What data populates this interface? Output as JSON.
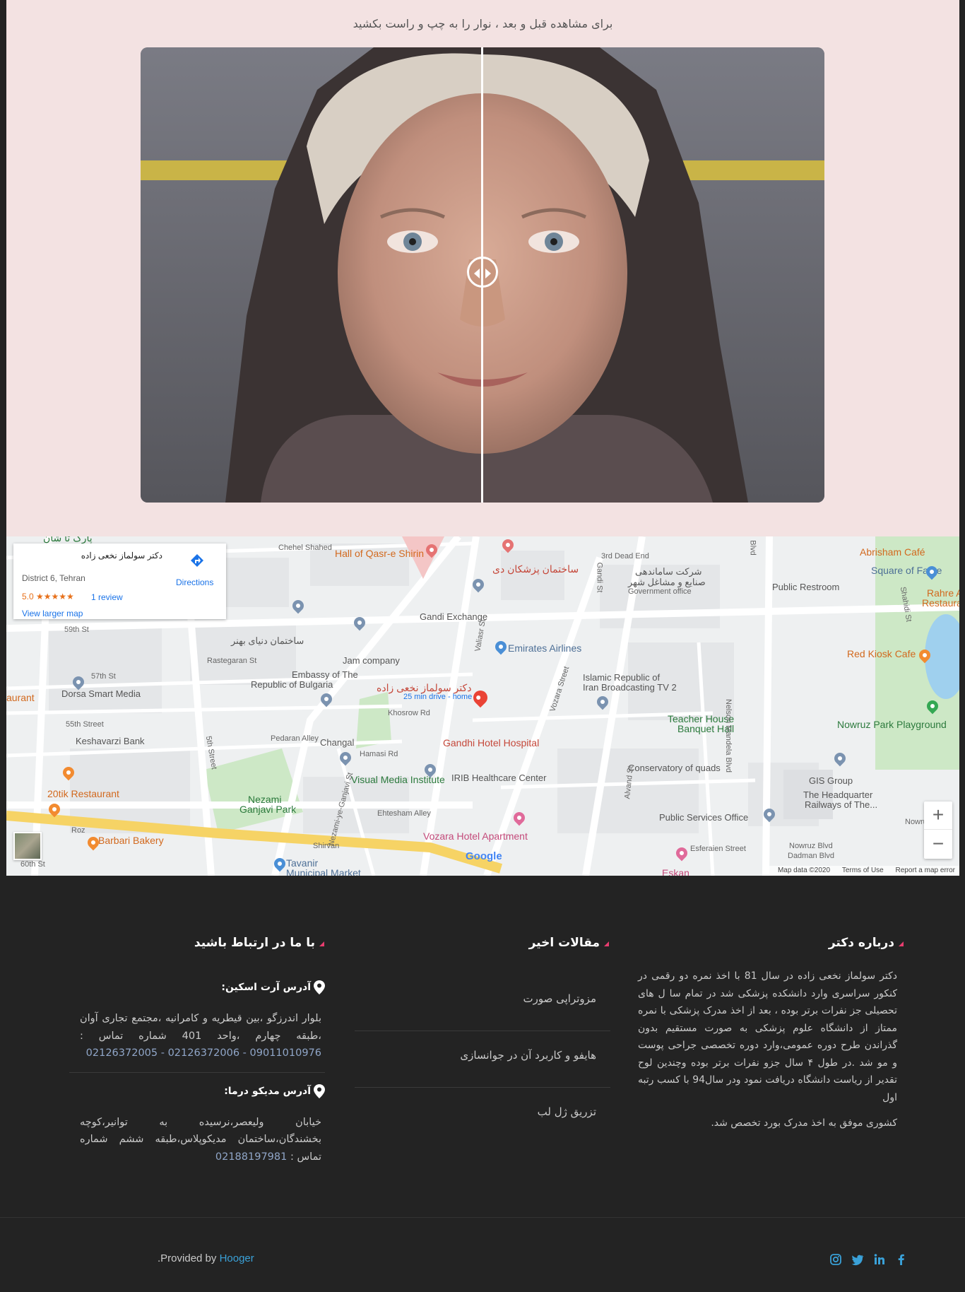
{
  "before_after": {
    "hint": "برای مشاهده قبل و بعد ، نوار را به چپ و راست بکشید"
  },
  "map": {
    "card": {
      "place_name": "دکتر سولماز نخعی زاده",
      "area": "District 6, Tehran",
      "rating": "5.0 ★★★★★",
      "reviews": "1 review",
      "larger_map": "View larger map",
      "directions": "Directions"
    },
    "labels": {
      "park_top": "پارک تا شان",
      "chehel_shahed": "Chehel Shahed",
      "hall_qasr": "Hall of Qasr-e Shirin",
      "medical_building": "ساختمان پزشکان دی",
      "third_dead_end": "3rd Dead End",
      "gandi_st": "Gandi St",
      "blvd": "Blvd",
      "gov_org": "شرکت ساماندهی",
      "gov_org2": "صنایع و مشاغل شهر",
      "gov_office": "Government office",
      "public_restroom": "Public Restroom",
      "abrisham_cafe": "Abrisham Café",
      "square_of_fame": "Square of Fame",
      "rahre_restaurant": "Rahre Abi Ca",
      "restaurant2": "Restaura",
      "gandi_exchange": "Gandi Exchange",
      "st59": "59th St",
      "building_dubai": "ساختمان دنیای بهنر",
      "rastegaran": "Rastegaran St",
      "jam_company": "Jam company",
      "emirates": "Emirates Airlines",
      "st57": "57th St",
      "embassy1": "Embassy of The",
      "embassy2": "Republic of Bulgaria",
      "dorsa": "Dorsa Smart Media",
      "restaurant_left": "aurant",
      "doctor_pin": "دکتر سولماز نخعی زاده",
      "drive_time": "25 min drive - home",
      "khosrow": "Khosrow Rd",
      "vozara": "Vozara Street",
      "iran_tv1": "Islamic Republic of",
      "iran_tv2": "Iran Broadcasting TV 2",
      "red_kiosk": "Red Kiosk Cafe",
      "teacher1": "Teacher House",
      "teacher2": "Banquet Hall",
      "nowruz": "Nowruz Park Playground",
      "st55": "55th Street",
      "keshavarzi": "Keshavarzi Bank",
      "pedaran": "Pedaran Alley",
      "changal": "Changal",
      "gandhi_hospital": "Gandhi Hotel Hospital",
      "hamasi": "Hamasi Rd",
      "nelson": "Nelson Mandela Blvd",
      "conservatory": "Conservatory of quads",
      "gis": "GIS Group",
      "headquarter1": "The Headquarter",
      "headquarter2": "Railways of The...",
      "visual_media": "Visual Media Institute",
      "irib": "IRIB Healthcare Center",
      "tik_restaurant": "20tik Restaurant",
      "nezami1": "Nezami",
      "nezami2": "Ganjavi Park",
      "ehtesham": "Ehtesham Alley",
      "public_services": "Public Services Office",
      "barbari": "Barbari Bakery",
      "vozara_hotel": "Vozara Hotel Apartment",
      "shirvan": "Shirvan",
      "esferaien": "Esferaien Street",
      "nowruz_blvd": "Nowruz Blvd",
      "dadman": "Dadman Blvd",
      "tavanir1": "Tavanir",
      "tavanir2": "Municipal Market",
      "st60": "60th St",
      "roz": "Roz",
      "eskan": "Eskan",
      "st5": "5th Street",
      "shahidi": "Shahidi St",
      "vallasr": "Valiasr St",
      "alvand": "Alvand St",
      "nezami_ganjavi": "Nezami-ye-Ganjavi St",
      "now_right": "Nowru"
    },
    "zoom_in": "+",
    "zoom_out": "−",
    "google": "Google",
    "footer": {
      "data": "Map data ©2020",
      "terms": "Terms of Use",
      "report": "Report a map error"
    }
  },
  "footer": {
    "about": {
      "title": "درباره دکتر",
      "p1": "دکتر سولماز نخعی زاده در سال 81 با اخذ نمره دو رقمی در کنکور سراسری وارد دانشکده پزشکی شد در تمام سا ل های تحصیلی جز نفرات برتر بوده ، بعد از اخذ مدرک پزشکی با نمره ممتاز از دانشگاه علوم پزشکی به صورت مستقیم بدون گذراندن طرح دوره عمومی،وارد دوره تخصصی جراحی پوست و مو شد .در طول ۴ سال جزو نفرات برتر بوده وچندین لوح تقدیر از ریاست دانشگاه دریافت نمود ودر سال94 با کسب رتبه اول",
      "p2": "کشوری موفق به اخذ مدرک بورد تخصص شد."
    },
    "articles": {
      "title": "مقالات اخیر",
      "items": [
        "مزوتراپی صورت",
        "هایفو و کاربرد آن در جوانسازی",
        "تزریق ژل لب"
      ]
    },
    "contact": {
      "title": "با ما در ارتباط باشید",
      "address1_title": "آدرس آرت اسکین:",
      "address1_text": "بلوار اندرزگو ،بین قیطریه و کامرانیه ،مجتمع تجاری آوان ،طبقه چهارم ،واحد 401 شماره تماس :",
      "address1_phone": "09011010976 - 02126372006 - 02126372005",
      "address2_title": "آدرس مدیکو درما:",
      "address2_text": "خیابان ولیعصر،نرسیده به توانیر،کوچه بخشندگان،ساختمان مدیکوپلاس،طبقه ششم شماره تماس :",
      "address2_phone": "02188197981"
    }
  },
  "bottom": {
    "provided_prefix": "Provided by",
    "brand": "Hooger",
    "suffix": "."
  },
  "colors": {
    "accent": "#e83d6f",
    "link": "#3aa1d8",
    "footer_bg": "#232323",
    "section_bg": "#f3e2e2"
  }
}
